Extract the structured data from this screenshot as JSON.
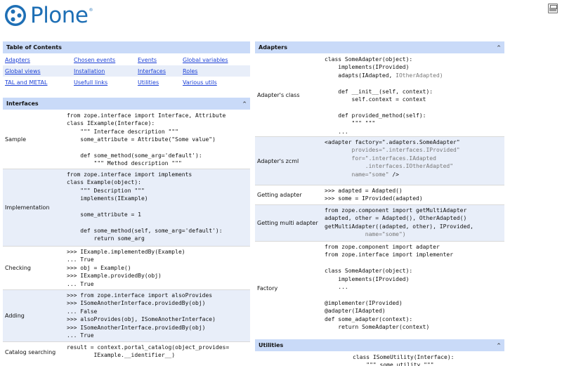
{
  "brand": {
    "name": "Plone",
    "reg": "®"
  },
  "toc": {
    "title": "Table of Contents",
    "rows": [
      [
        "Adapters",
        "Chosen events",
        "Events",
        "Global variables"
      ],
      [
        "Global views",
        "Installation",
        "Interfaces",
        "Roles"
      ],
      [
        "TAL and METAL",
        "Usefull links",
        "Utilities",
        "Various utils"
      ]
    ]
  },
  "interfaces": {
    "title": "Interfaces",
    "caret": "^",
    "rows": [
      {
        "label": "Sample",
        "code": "from zope.interface import Interface, Attribute\nclass IExample(Interface):\n    \"\"\" Interface description \"\"\"\n    some_attribute = Attribute(\"Some value\")\n\n    def some_method(some_arg='default'):\n        \"\"\" Method description \"\"\""
      },
      {
        "label": "Implementation",
        "code": "from zope.interface import implements\nclass Example(object):\n    \"\"\" Description \"\"\"\n    implements(IExample)\n\n    some_attribute = 1\n\n    def some_method(self, some_arg='default'):\n        return some_arg"
      },
      {
        "label": "Checking",
        "code": ">>> IExample.implementedBy(Example)\n... True\n>>> obj = Example()\n>>> IExample.providedBy(obj)\n... True"
      },
      {
        "label": "Adding",
        "code": ">>> from zope.interface import alsoProvides\n>>> ISomeAnotherInterface.providedBy(obj)\n... False\n>>> alsoProvides(obj, ISomeAnotherInterface)\n>>> ISomeAnotherInterface.providedBy(obj)\n... True"
      },
      {
        "label": "Catalog searching",
        "code": "result = context.portal_catalog(object_provides=\n        IExample.__identifier__)"
      }
    ]
  },
  "adapters": {
    "title": "Adapters",
    "caret": "^",
    "rows": [
      {
        "label": "Adapter's class",
        "code": "class SomeAdapter(object):\n    implements(IProvided)\n    adapts(IAdapted, IOtherAdapted)\n\n    def __init__(self, context):\n        self.context = context\n\n    def provided_method(self):\n        \"\"\" \"\"\"\n    ..."
      },
      {
        "label": "Adapter's zcml",
        "zcml": true,
        "code_main": "<adapter factory=\".adapters.SomeAdapter\"",
        "code_rest": "\n        provides=\".interfaces.IProvided\"\n        for=\".interfaces.IAdapted\n            .interfaces.IOtherAdapted\"\n        name=\"some\" ",
        "code_end": "/>"
      },
      {
        "label": "Getting adapter",
        "code": ">>> adapted = Adapted()\n>>> some = IProvided(adapted)"
      },
      {
        "label": "Getting multi adapter",
        "code": "from zope.component import getMultiAdapter\nadapted, other = Adapted(), OtherAdapted()\ngetMultiAdapter((adapted, other), IProvided,\n            name=\"some\")"
      },
      {
        "label": "Factory",
        "code": "from zope.component import adapter\nfrom zope.interface import implementer\n\nclass SomeAdapter(object):\n    implements(IProvided)\n    ...\n\n@implementer(IProvided)\n@adapter(IAdapted)\ndef some_adapter(context):\n    return SomeAdapter(context)"
      }
    ]
  },
  "utilities": {
    "title": "Utilities",
    "caret": "^",
    "code": "class ISomeUtility(Interface):\n    \"\"\" some utility \"\"\""
  }
}
